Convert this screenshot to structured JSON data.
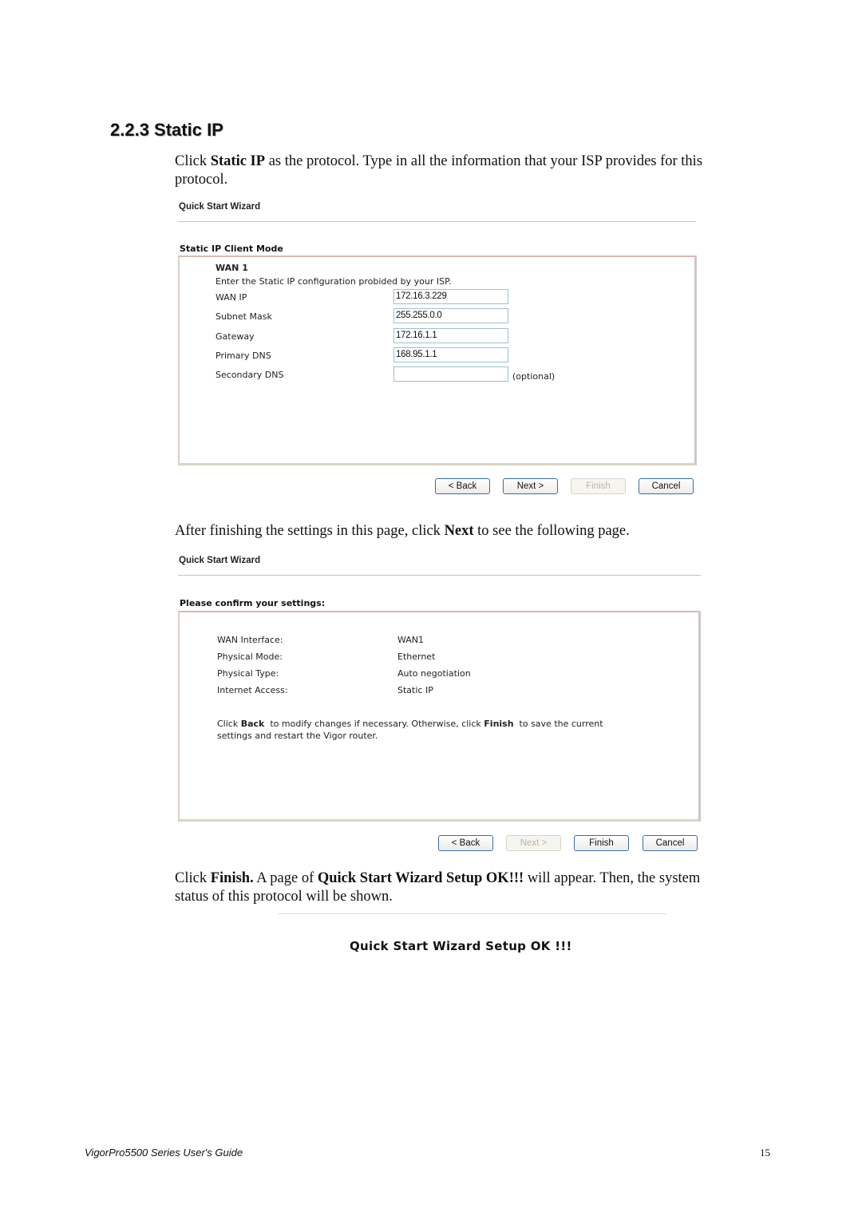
{
  "section": {
    "number": "2.2.3",
    "title": "2.2.3 Static IP"
  },
  "intro": {
    "p1_prefix": "Click ",
    "p1_bold": "Static IP",
    "p1_suffix": " as the protocol. Type in all the information that your ISP provides for this",
    "p1_line2": "protocol."
  },
  "screen1": {
    "wizard_title": "Quick Start Wizard",
    "panel_title": "Static IP Client Mode",
    "wan_label": "WAN 1",
    "instruction": "Enter the Static IP configuration probided by your ISP.",
    "fields": [
      {
        "label": "WAN IP",
        "value": "172.16.3.229"
      },
      {
        "label": "Subnet Mask",
        "value": "255.255.0.0"
      },
      {
        "label": "Gateway",
        "value": "172.16.1.1"
      },
      {
        "label": "Primary DNS",
        "value": "168.95.1.1"
      },
      {
        "label": "Secondary DNS",
        "value": "",
        "note": "(optional)"
      }
    ],
    "buttons": {
      "back": "< Back",
      "next": "Next >",
      "finish": "Finish",
      "cancel": "Cancel"
    },
    "button_states": {
      "back": "enabled",
      "next": "enabled",
      "finish": "disabled",
      "cancel": "enabled"
    }
  },
  "mid_text": {
    "prefix": "After finishing the settings in this page, click ",
    "bold": "Next",
    "suffix": " to see the following page."
  },
  "screen2": {
    "wizard_title": "Quick Start Wizard",
    "panel_title": "Please confirm your settings:",
    "rows": [
      {
        "label": "WAN Interface:",
        "value": "WAN1"
      },
      {
        "label": "Physical Mode:",
        "value": "Ethernet"
      },
      {
        "label": "Physical Type:",
        "value": "Auto negotiation"
      },
      {
        "label": "Internet Access:",
        "value": "Static IP"
      }
    ],
    "note": {
      "t1": "Click ",
      "b1": "Back",
      "t2": "  to modify changes if necessary. Otherwise, click ",
      "b2": "Finish",
      "t3": "  to save the current",
      "line2": "settings and restart the Vigor router."
    },
    "buttons": {
      "back": "< Back",
      "next": "Next >",
      "finish": "Finish",
      "cancel": "Cancel"
    },
    "button_states": {
      "back": "enabled",
      "next": "disabled",
      "finish": "enabled",
      "cancel": "enabled"
    }
  },
  "final_text": {
    "t1": "Click ",
    "b1": "Finish.",
    "t2": " A page of ",
    "b2": "Quick Start Wizard Setup OK!!!",
    "t3": " will appear. Then, the system",
    "line2": "status of this protocol will be shown."
  },
  "screen3": {
    "message": "Quick Start Wizard Setup OK !!!"
  },
  "footer": {
    "guide": "VigorPro5500 Series User's Guide",
    "page": "15"
  }
}
